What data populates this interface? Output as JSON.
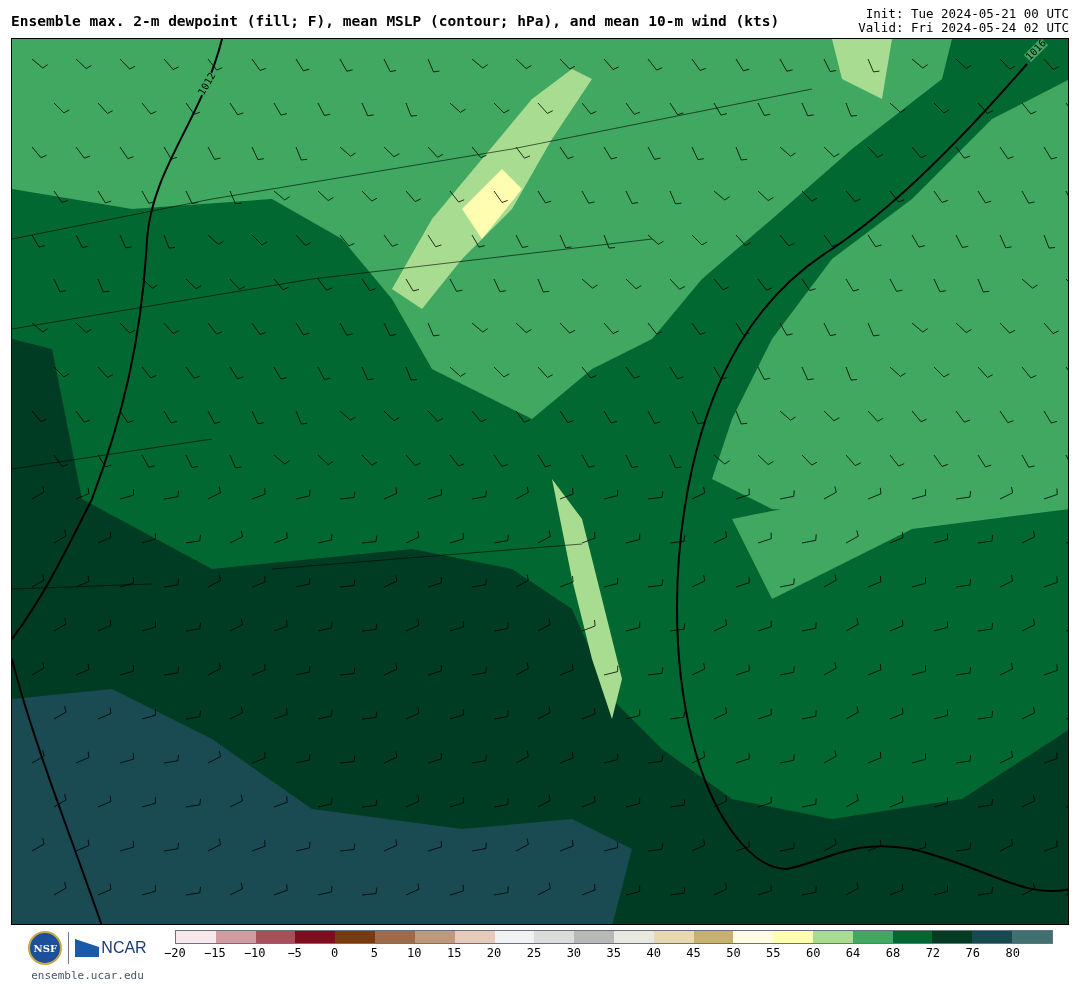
{
  "header": {
    "title": "Ensemble max. 2-m dewpoint (fill; F), mean MSLP (contour; hPa), and mean 10-m wind (kts)",
    "init": "Init: Tue 2024-05-21 00 UTC",
    "valid": "Valid: Fri 2024-05-24 02 UTC"
  },
  "map": {
    "contour_labels": [
      "1012",
      "1016"
    ]
  },
  "footer": {
    "nsf_logo": "NSF",
    "ncar_logo": "NCAR",
    "url": "ensemble.ucar.edu"
  },
  "colorbar": {
    "ticks": [
      "−20",
      "−15",
      "−10",
      "−5",
      "0",
      "5",
      "10",
      "15",
      "20",
      "25",
      "30",
      "35",
      "40",
      "45",
      "50",
      "55",
      "60",
      "64",
      "68",
      "72",
      "76",
      "80"
    ],
    "segments": [
      {
        "color": "#f6e8ec"
      },
      {
        "color": "#d29ca2"
      },
      {
        "color": "#a8505a"
      },
      {
        "color": "#800c1c"
      },
      {
        "color": "#7a3a10"
      },
      {
        "color": "#a06a48"
      },
      {
        "color": "#c0987c"
      },
      {
        "color": "#e8cab8"
      },
      {
        "color": "#f2f2f4"
      },
      {
        "color": "#dcdcdc"
      },
      {
        "color": "#b8b8b8"
      },
      {
        "color": "#e8e8e0"
      },
      {
        "color": "#e8d8b0"
      },
      {
        "color": "#c8b070"
      },
      {
        "color": "#fffde0"
      },
      {
        "color": "#ffffb0"
      },
      {
        "color": "#a8dc90"
      },
      {
        "color": "#40a860"
      },
      {
        "color": "#006830"
      },
      {
        "color": "#003c24"
      },
      {
        "color": "#144a50"
      },
      {
        "color": "#407070"
      }
    ]
  }
}
